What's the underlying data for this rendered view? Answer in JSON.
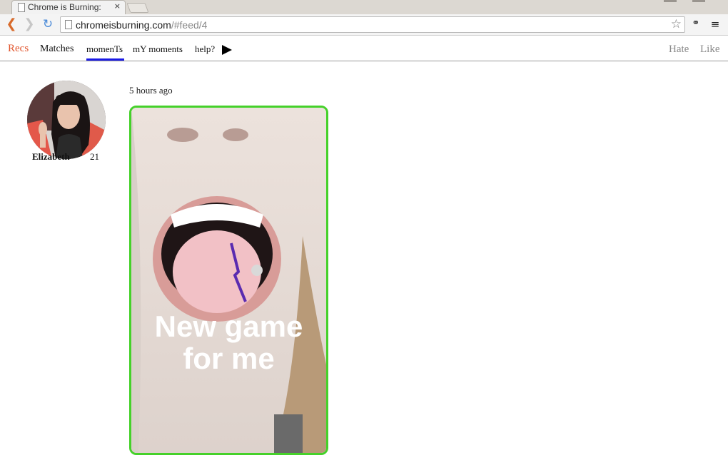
{
  "browser": {
    "tab_title": "Chrome is Burning: ",
    "tab_close": "×",
    "url_host": "chromeisburning.com",
    "url_path": "/#feed/4",
    "icons": [
      "back-arrow-icon",
      "forward-arrow-icon",
      "reload-icon",
      "page-icon",
      "star-icon",
      "extension-icon",
      "menu-icon"
    ]
  },
  "nav": {
    "recs": "Recs",
    "matches": "Matches",
    "moments": "momenTs",
    "my_moments": "mY moments",
    "help": "help?",
    "hate": "Hate",
    "like": "Like",
    "accent_color": "#e1542c",
    "active_underline_color": "#1a1ae6"
  },
  "profile": {
    "name": "Elizabeth",
    "age": "21"
  },
  "moment": {
    "timestamp": "5 hours ago",
    "caption_line1": "New game",
    "caption_line2": "for me",
    "border_color": "#45d12a"
  }
}
